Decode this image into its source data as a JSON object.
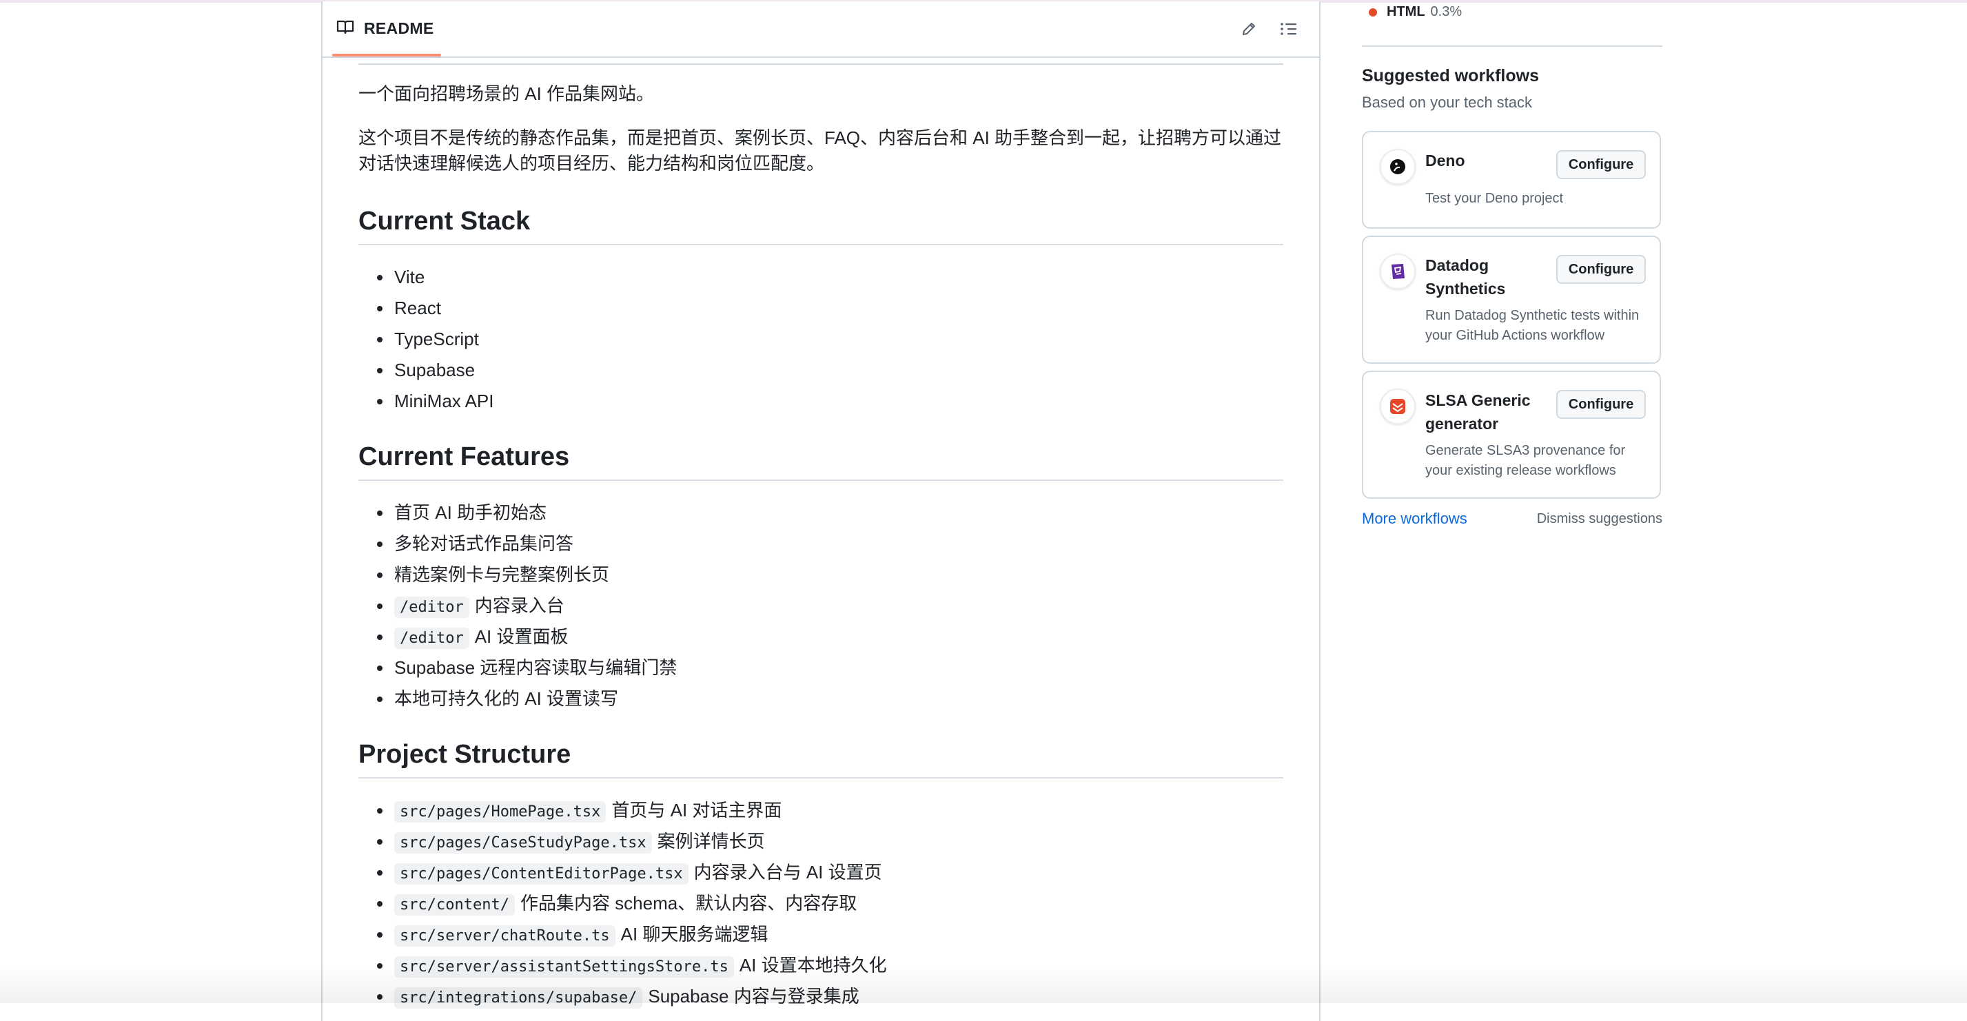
{
  "readme": {
    "tab_label": "README",
    "intro": "一个面向招聘场景的 AI 作品集网站。",
    "description": "这个项目不是传统的静态作品集，而是把首页、案例长页、FAQ、内容后台和 AI 助手整合到一起，让招聘方可以通过对话快速理解候选人的项目经历、能力结构和岗位匹配度。",
    "sections": {
      "stack": {
        "heading": "Current Stack",
        "items": [
          "Vite",
          "React",
          "TypeScript",
          "Supabase",
          "MiniMax API"
        ]
      },
      "features": {
        "heading": "Current Features",
        "items": [
          {
            "code": "",
            "text": "首页 AI 助手初始态"
          },
          {
            "code": "",
            "text": "多轮对话式作品集问答"
          },
          {
            "code": "",
            "text": "精选案例卡与完整案例长页"
          },
          {
            "code": "/editor",
            "text": "内容录入台"
          },
          {
            "code": "/editor",
            "text": "AI 设置面板"
          },
          {
            "code": "",
            "text": "Supabase 远程内容读取与编辑门禁"
          },
          {
            "code": "",
            "text": "本地可持久化的 AI 设置读写"
          }
        ]
      },
      "structure": {
        "heading": "Project Structure",
        "items": [
          {
            "code": "src/pages/HomePage.tsx",
            "text": "首页与 AI 对话主界面"
          },
          {
            "code": "src/pages/CaseStudyPage.tsx",
            "text": "案例详情长页"
          },
          {
            "code": "src/pages/ContentEditorPage.tsx",
            "text": "内容录入台与 AI 设置页"
          },
          {
            "code": "src/content/",
            "text": "作品集内容 schema、默认内容、内容存取"
          },
          {
            "code": "src/server/chatRoute.ts",
            "text": "AI 聊天服务端逻辑"
          },
          {
            "code": "src/server/assistantSettingsStore.ts",
            "text": "AI 设置本地持久化"
          },
          {
            "code": "src/integrations/supabase/",
            "text": "Supabase 内容与登录集成"
          }
        ]
      }
    }
  },
  "sidebar": {
    "language": {
      "name": "HTML",
      "percent": "0.3%",
      "color": "#e34c26"
    },
    "suggested_title": "Suggested workflows",
    "suggested_subtitle": "Based on your tech stack",
    "workflows": [
      {
        "name": "Deno",
        "description": "Test your Deno project",
        "button": "Configure",
        "icon": "deno-icon"
      },
      {
        "name": "Datadog Synthetics",
        "description": "Run Datadog Synthetic tests within your GitHub Actions workflow",
        "button": "Configure",
        "icon": "datadog-icon"
      },
      {
        "name": "SLSA Generic generator",
        "description": "Generate SLSA3 provenance for your existing release workflows",
        "button": "Configure",
        "icon": "slsa-icon"
      }
    ],
    "more_workflows": "More workflows",
    "dismiss": "Dismiss suggestions"
  },
  "colors": {
    "accent_link": "#0969da",
    "tab_underline": "#fd8c73",
    "text": "#1f2328",
    "muted": "#59636e"
  }
}
